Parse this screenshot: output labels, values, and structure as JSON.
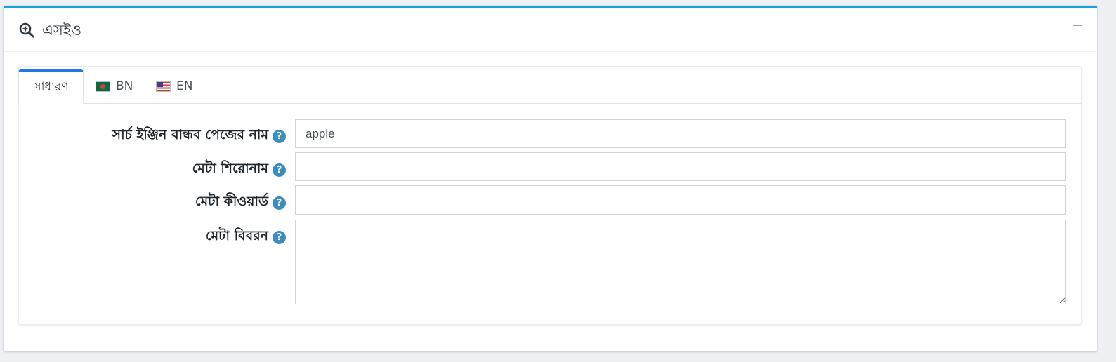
{
  "card": {
    "title": "এসইও",
    "title_icon": "search-plus-icon",
    "collapse_icon": "minus-icon"
  },
  "tabs": [
    {
      "label": "সাধারণ",
      "active": true
    },
    {
      "label": "BN",
      "flag": "bangladesh-flag-icon"
    },
    {
      "label": "EN",
      "flag": "us-flag-icon"
    }
  ],
  "fields": {
    "seo_name": {
      "label": "সার্চ ইঞ্জিন বান্ধব পেজের নাম",
      "value": "apple"
    },
    "meta_title": {
      "label": "মেটা শিরোনাম",
      "value": ""
    },
    "meta_keywords": {
      "label": "মেটা কীওয়ার্ড",
      "value": ""
    },
    "meta_description": {
      "label": "মেটা বিবরন",
      "value": ""
    }
  },
  "colors": {
    "accent": "#17a2d8",
    "tab_active": "#1f7ae0",
    "help": "#3c8dbc"
  }
}
